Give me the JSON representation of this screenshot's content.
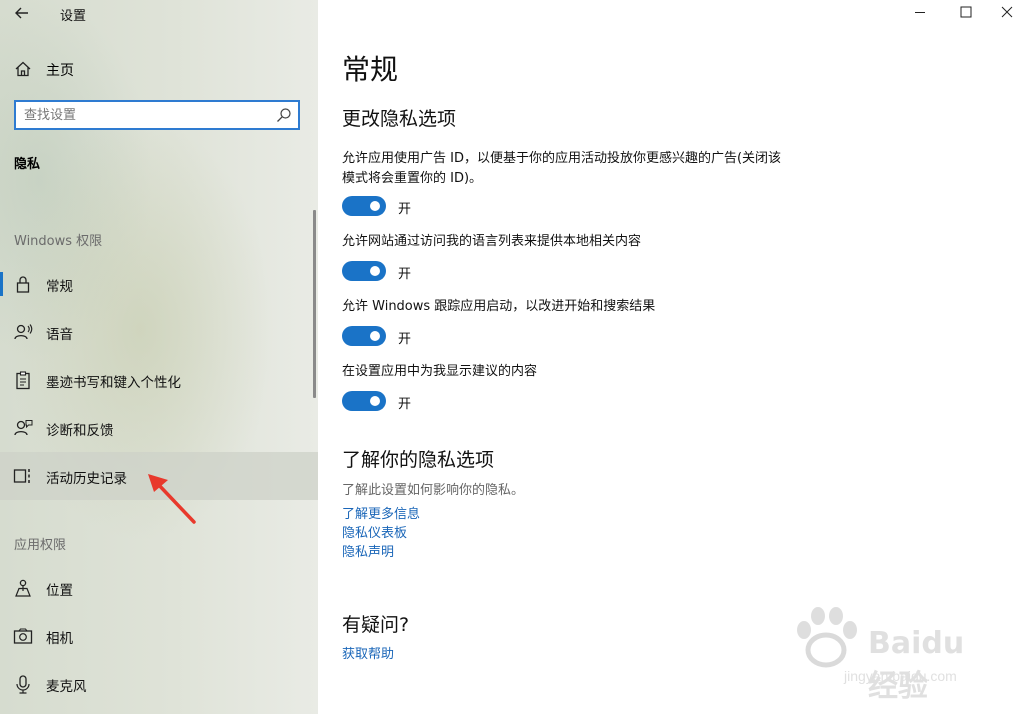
{
  "titlebar": {
    "back_glyph": "←",
    "app_title": "设置"
  },
  "sidebar": {
    "home_label": "主页",
    "search": {
      "placeholder": "查找设置",
      "value": ""
    },
    "category": "隐私",
    "group_windows": "Windows 权限",
    "windows_items": [
      {
        "label": "常规",
        "icon": "lock-icon",
        "active": true
      },
      {
        "label": "语音",
        "icon": "speech-icon"
      },
      {
        "label": "墨迹书写和键入个性化",
        "icon": "clipboard-icon"
      },
      {
        "label": "诊断和反馈",
        "icon": "feedback-icon"
      },
      {
        "label": "活动历史记录",
        "icon": "timeline-icon",
        "hover": true
      }
    ],
    "group_app": "应用权限",
    "app_items": [
      {
        "label": "位置",
        "icon": "location-icon"
      },
      {
        "label": "相机",
        "icon": "camera-icon"
      },
      {
        "label": "麦克风",
        "icon": "microphone-icon"
      }
    ]
  },
  "main": {
    "title": "常规",
    "section1_title": "更改隐私选项",
    "settings": [
      {
        "description": "允许应用使用广告 ID，以便基于你的应用活动投放你更感兴趣的广告(关闭该模式将会重置你的 ID)。",
        "state": "开",
        "on": true
      },
      {
        "description": "允许网站通过访问我的语言列表来提供本地相关内容",
        "state": "开",
        "on": true
      },
      {
        "description": "允许 Windows 跟踪应用启动，以改进开始和搜索结果",
        "state": "开",
        "on": true
      },
      {
        "description": "在设置应用中为我显示建议的内容",
        "state": "开",
        "on": true
      }
    ],
    "section2_title": "了解你的隐私选项",
    "section2_desc": "了解此设置如何影响你的隐私。",
    "links": [
      "了解更多信息",
      "隐私仪表板",
      "隐私声明"
    ],
    "section3_title": "有疑问?",
    "help_link": "获取帮助"
  },
  "watermark": {
    "text": "Baidu经验",
    "sub": "jingyan.baidu.com"
  },
  "colors": {
    "accent": "#1a73c7",
    "link": "#1a66b8",
    "annotation_arrow": "#e8392c"
  }
}
